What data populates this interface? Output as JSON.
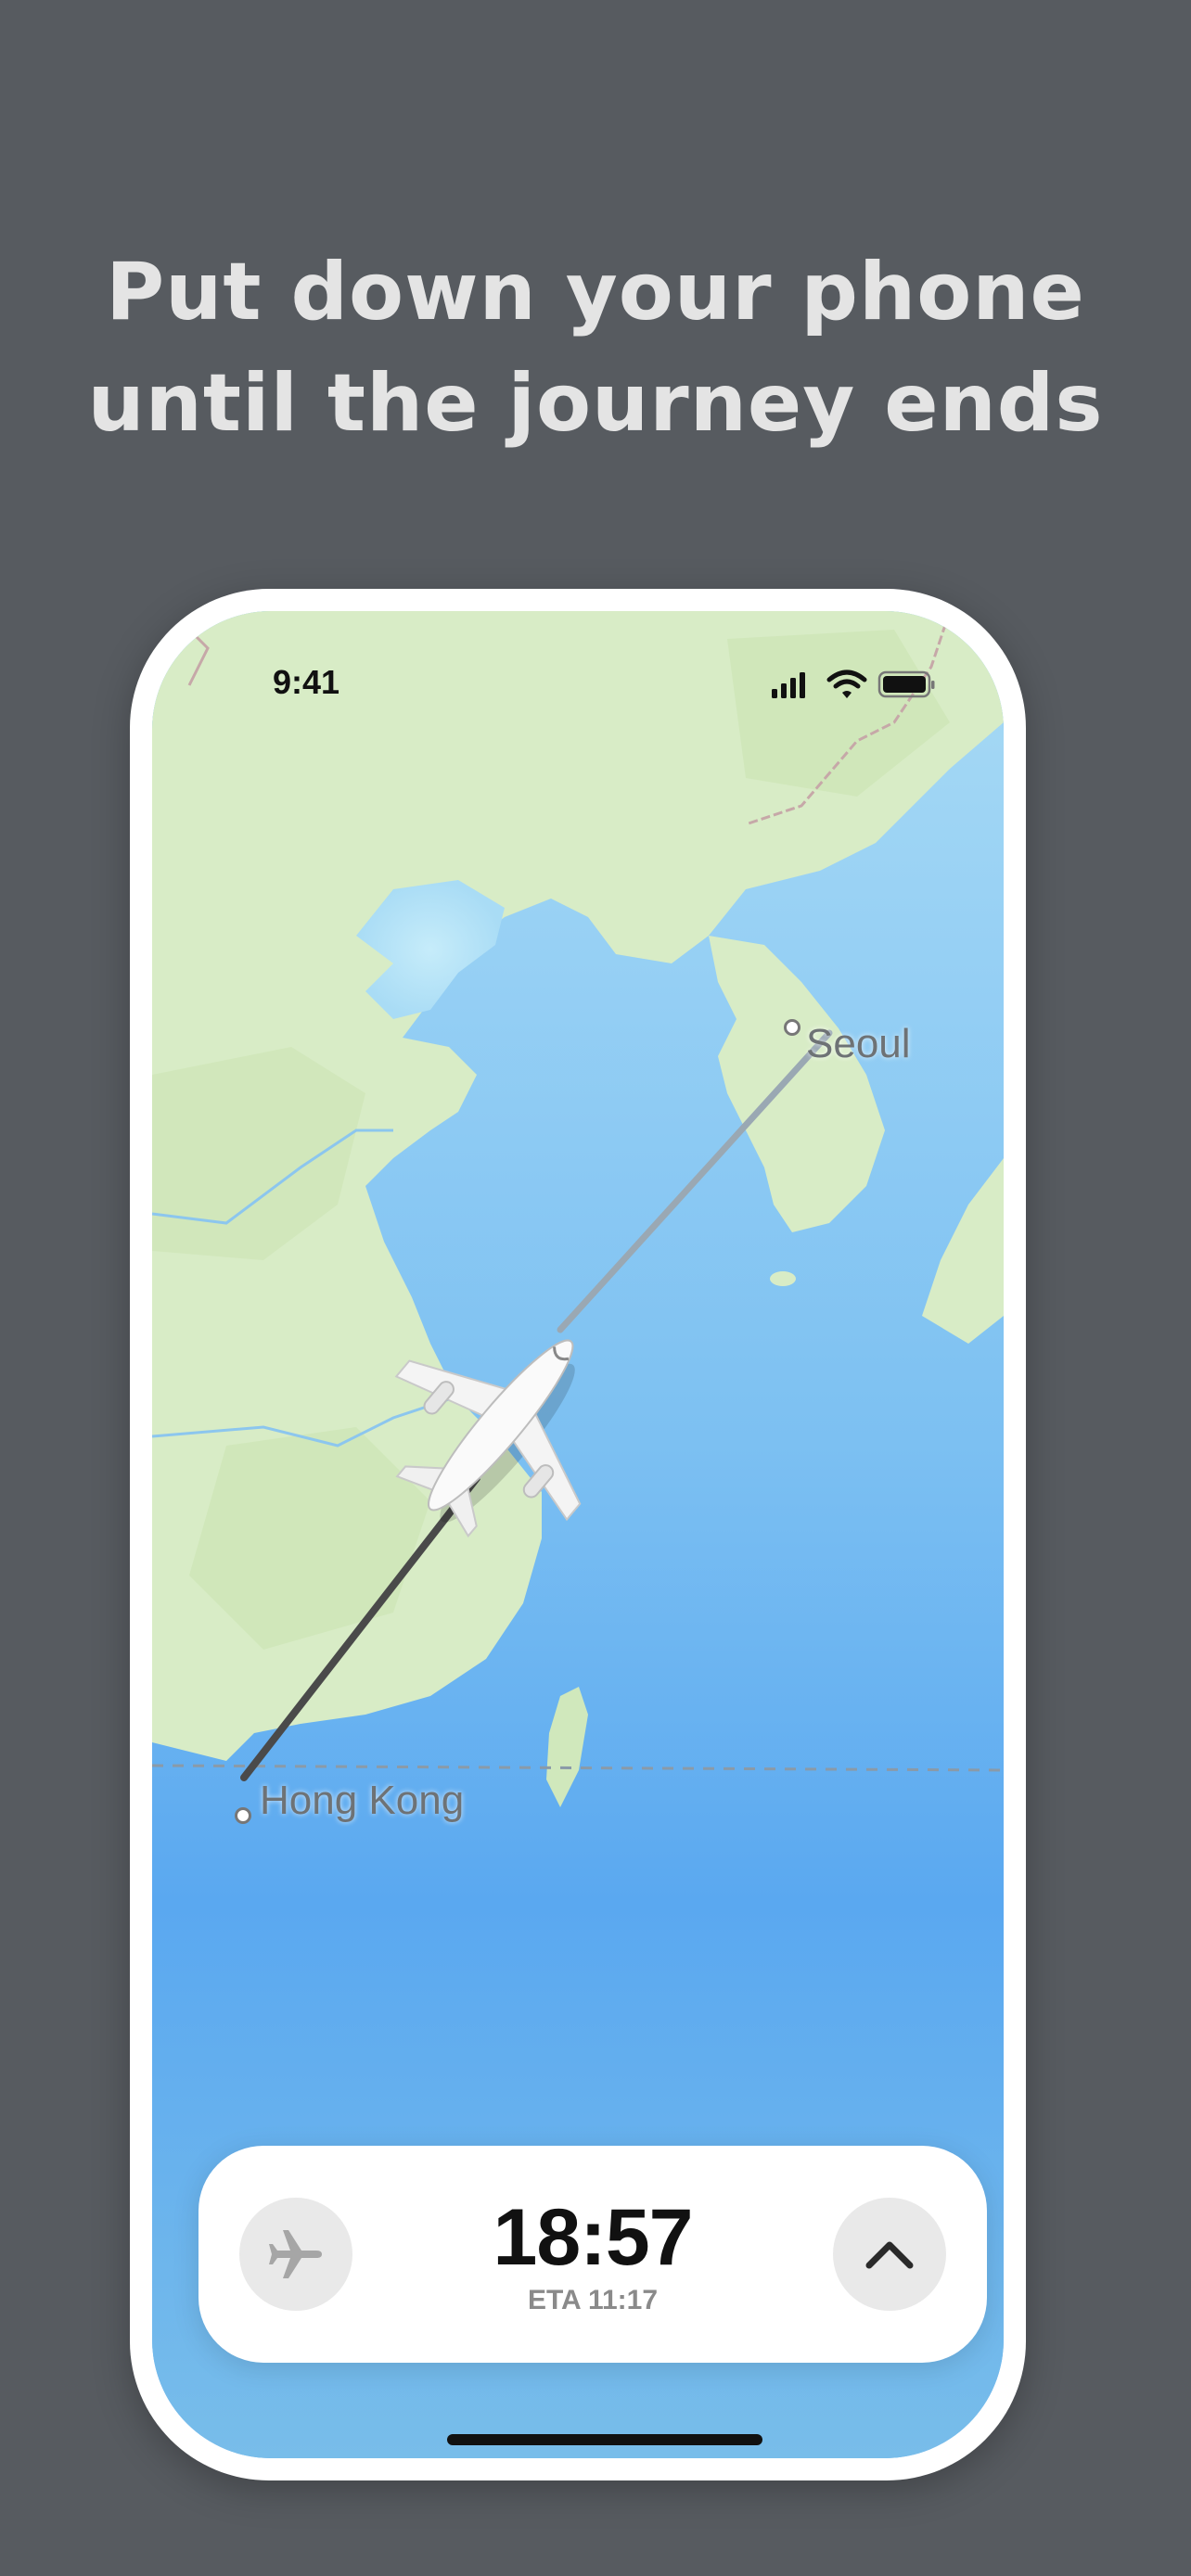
{
  "headline": {
    "line1": "Put down your phone",
    "line2": "until the journey ends"
  },
  "status_bar": {
    "time": "9:41",
    "icons": [
      "signal-icon",
      "wifi-icon",
      "battery-icon"
    ]
  },
  "map": {
    "origin": "Hong Kong",
    "destination": "Seoul"
  },
  "flight_card": {
    "countdown": "18:57",
    "eta": "ETA 11:17",
    "left_icon": "airplane-icon",
    "right_icon": "chevron-up-icon"
  },
  "colors": {
    "background": "#575b60",
    "headline": "#e4e4e4",
    "sea": "#63aef0",
    "land": "#d9ecc8",
    "route_flown": "#4a4a4a",
    "route_remaining": "#9aa8b3"
  }
}
